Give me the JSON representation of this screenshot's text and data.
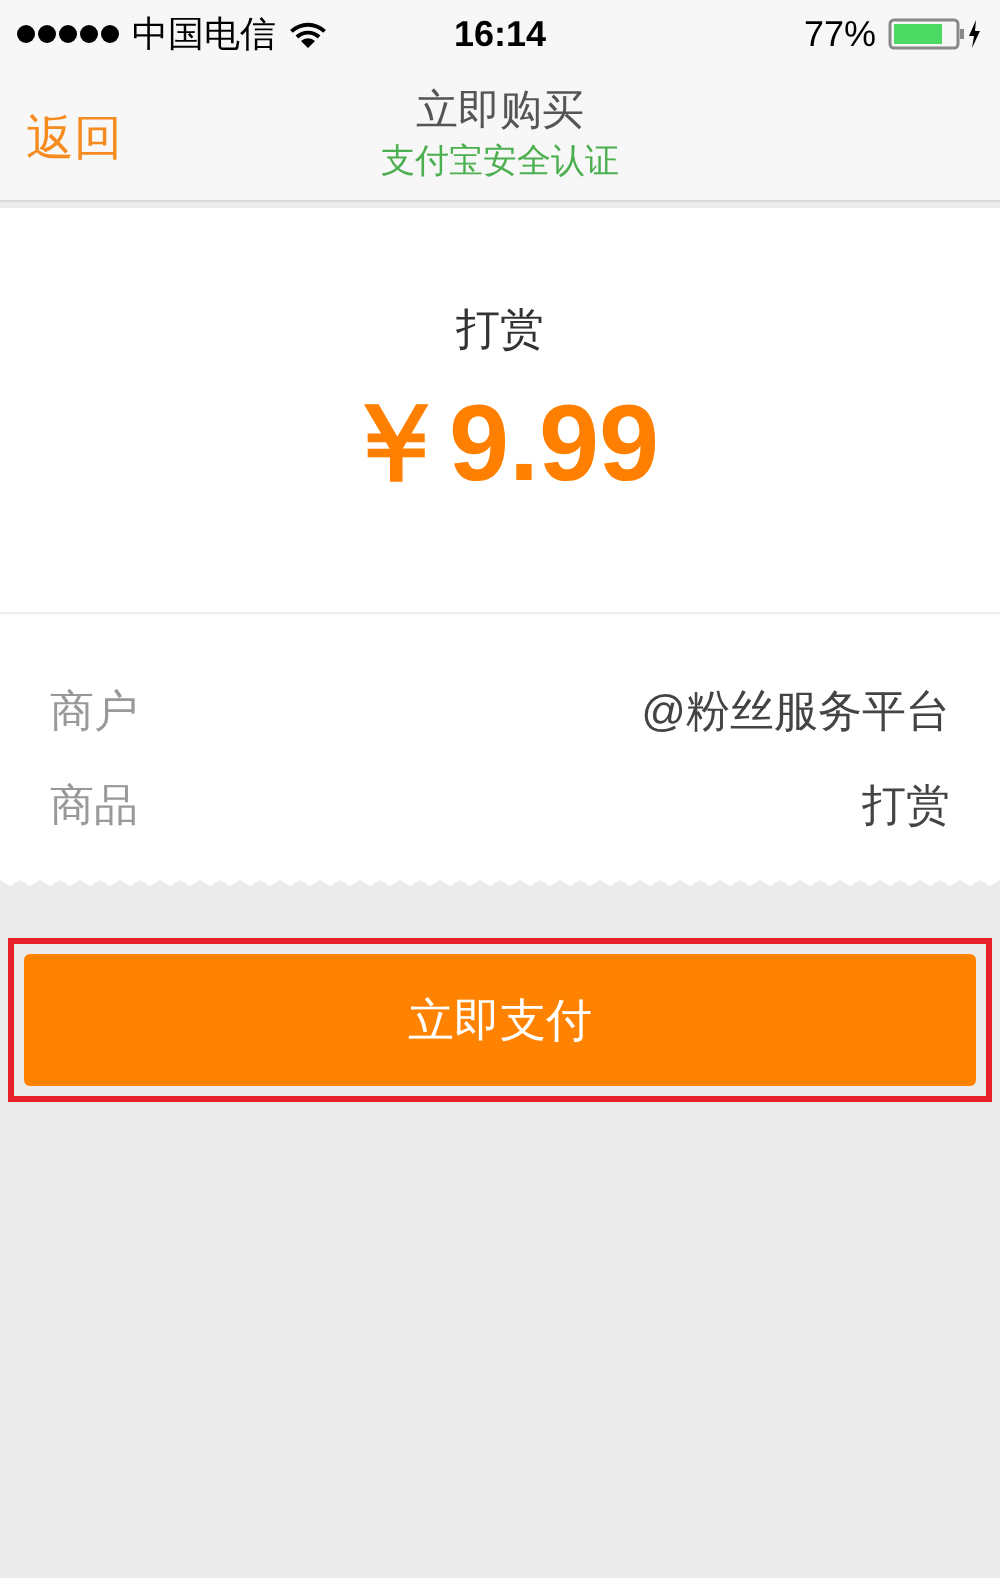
{
  "status_bar": {
    "carrier": "中国电信",
    "time": "16:14",
    "battery": "77%"
  },
  "nav": {
    "back": "返回",
    "title": "立即购买",
    "subtitle": "支付宝安全认证"
  },
  "order": {
    "title": "打赏",
    "price": "￥9.99"
  },
  "details": [
    {
      "label": "商户",
      "value": "@粉丝服务平台"
    },
    {
      "label": "商品",
      "value": "打赏"
    }
  ],
  "pay_button": {
    "label": "立即支付",
    "highlighted": true
  }
}
